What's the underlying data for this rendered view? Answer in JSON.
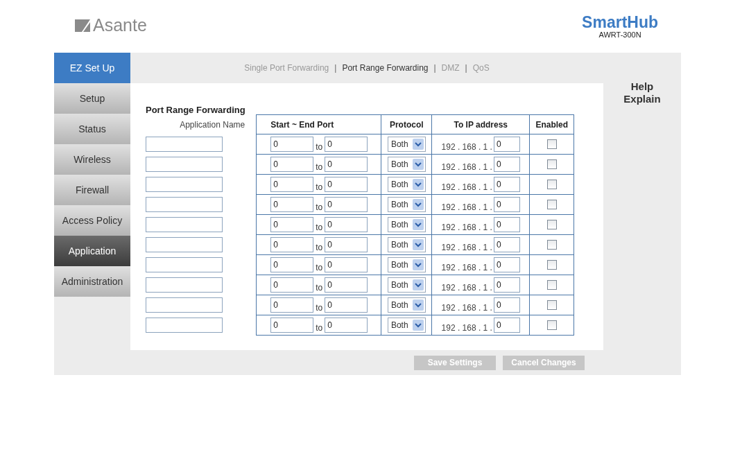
{
  "header": {
    "brand": "Asante",
    "product": "SmartHub",
    "model": "AWRT-300N"
  },
  "sidebar": {
    "items": [
      {
        "label": "EZ Set Up",
        "kind": "primary",
        "selected": false
      },
      {
        "label": "Setup",
        "kind": "normal",
        "selected": false
      },
      {
        "label": "Status",
        "kind": "normal",
        "selected": false
      },
      {
        "label": "Wireless",
        "kind": "normal",
        "selected": false
      },
      {
        "label": "Firewall",
        "kind": "normal",
        "selected": false
      },
      {
        "label": "Access Policy",
        "kind": "normal",
        "selected": false
      },
      {
        "label": "Application",
        "kind": "normal",
        "selected": true
      },
      {
        "label": "Administration",
        "kind": "normal",
        "selected": false
      }
    ]
  },
  "subnav": {
    "separator": "|",
    "items": [
      {
        "label": "Single Port Forwarding",
        "selected": false
      },
      {
        "label": "Port Range Forwarding",
        "selected": true
      },
      {
        "label": "DMZ",
        "selected": false
      },
      {
        "label": "QoS",
        "selected": false
      }
    ]
  },
  "form": {
    "title": "Port Range Forwarding",
    "columns": [
      "Application Name",
      "Start ~ End Port",
      "Protocol",
      "To IP address",
      "Enabled"
    ],
    "rows": [
      {
        "start": "0",
        "to": "to",
        "end": "0",
        "protocol": "Both",
        "ip_prefix": "192 . 168 . 1 .",
        "ip_last": "0",
        "enabled": false
      },
      {
        "start": "0",
        "to": "to",
        "end": "0",
        "protocol": "Both",
        "ip_prefix": "192 . 168 . 1 .",
        "ip_last": "0",
        "enabled": false
      },
      {
        "start": "0",
        "to": "to",
        "end": "0",
        "protocol": "Both",
        "ip_prefix": "192 . 168 . 1 .",
        "ip_last": "0",
        "enabled": false
      },
      {
        "start": "0",
        "to": "to",
        "end": "0",
        "protocol": "Both",
        "ip_prefix": "192 . 168 . 1 .",
        "ip_last": "0",
        "enabled": false
      },
      {
        "start": "0",
        "to": "to",
        "end": "0",
        "protocol": "Both",
        "ip_prefix": "192 . 168 . 1 .",
        "ip_last": "0",
        "enabled": false
      },
      {
        "start": "0",
        "to": "to",
        "end": "0",
        "protocol": "Both",
        "ip_prefix": "192 . 168 . 1 .",
        "ip_last": "0",
        "enabled": false
      },
      {
        "start": "0",
        "to": "to",
        "end": "0",
        "protocol": "Both",
        "ip_prefix": "192 . 168 . 1 .",
        "ip_last": "0",
        "enabled": false
      },
      {
        "start": "0",
        "to": "to",
        "end": "0",
        "protocol": "Both",
        "ip_prefix": "192 . 168 . 1 .",
        "ip_last": "0",
        "enabled": false
      },
      {
        "start": "0",
        "to": "to",
        "end": "0",
        "protocol": "Both",
        "ip_prefix": "192 . 168 . 1 .",
        "ip_last": "0",
        "enabled": false
      },
      {
        "start": "0",
        "to": "to",
        "end": "0",
        "protocol": "Both",
        "ip_prefix": "192 . 168 . 1 .",
        "ip_last": "0",
        "enabled": false
      }
    ]
  },
  "help": [
    "Help",
    "Explain"
  ],
  "buttons": [
    "Save Settings",
    "Cancel Changes"
  ]
}
